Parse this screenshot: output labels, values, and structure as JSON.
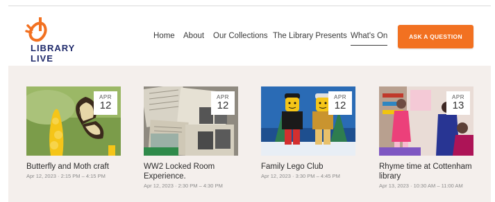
{
  "logo": {
    "line1": "LIBRARY",
    "line2": "LIVE",
    "colors": {
      "hand": "#f27121",
      "text": "#1f2a6b"
    }
  },
  "nav": {
    "items": [
      "Home",
      "About",
      "Our Collections",
      "The Library Presents",
      "What's On"
    ],
    "active": "What's On"
  },
  "cta": {
    "label": "ASK A QUESTION",
    "color": "#f27121"
  },
  "events": [
    {
      "month": "APR",
      "day": "12",
      "title": "Butterfly and Moth craft",
      "meta": "Apr 12, 2023 · 2:15 PM – 4:15 PM",
      "image": "butterfly-photo"
    },
    {
      "month": "APR",
      "day": "12",
      "title": "WW2 Locked Room Experience.",
      "meta": "Apr 12, 2023 · 2:30 PM – 4:30 PM",
      "image": "newspapers-photo"
    },
    {
      "month": "APR",
      "day": "12",
      "title": "Family Lego Club",
      "meta": "Apr 12, 2023 · 3:30 PM – 4:45 PM",
      "image": "lego-figures-photo"
    },
    {
      "month": "APR",
      "day": "13",
      "title": "Rhyme time at Cottenham library",
      "meta": "Apr 13, 2023 · 10:30 AM – 11:00 AM",
      "image": "children-library-photo"
    }
  ]
}
